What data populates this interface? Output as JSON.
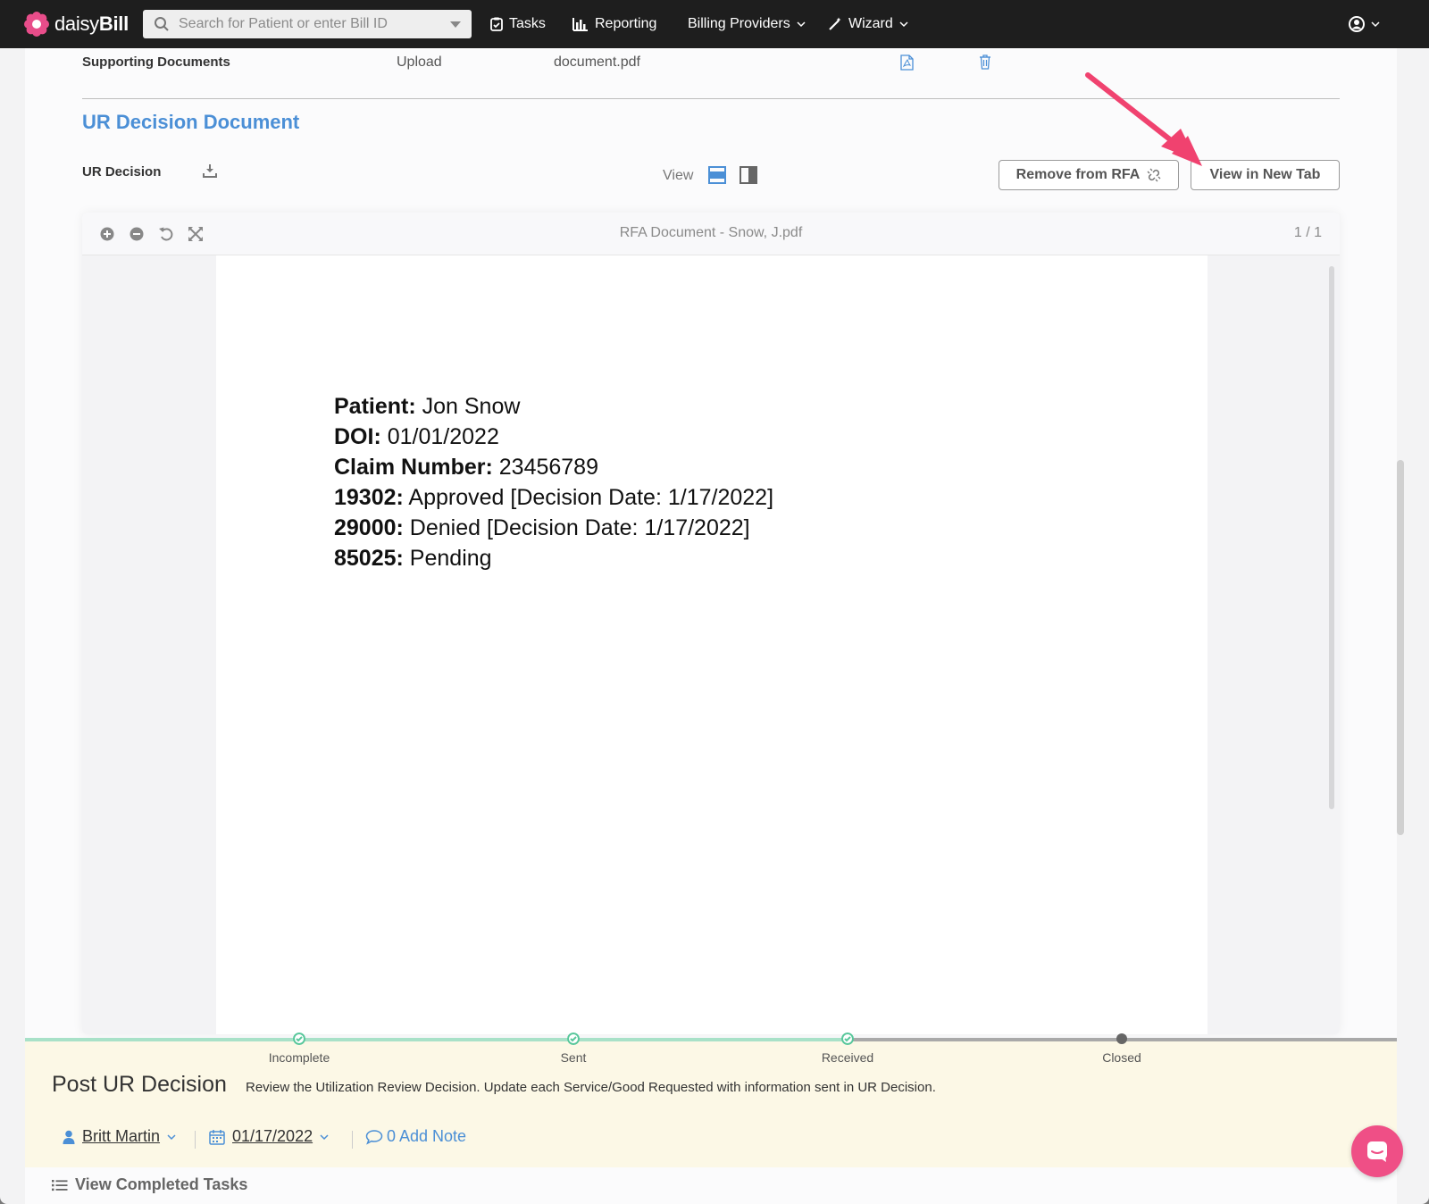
{
  "navbar": {
    "logo_text_light": "daisy",
    "logo_text_bold": "Bill",
    "search_placeholder": "Search for Patient or enter Bill ID",
    "items": {
      "tasks": "Tasks",
      "reporting": "Reporting",
      "billing_providers": "Billing Providers",
      "wizard": "Wizard"
    }
  },
  "supporting": {
    "label": "Supporting Documents",
    "source": "Upload",
    "filename": "document.pdf"
  },
  "ur_section": {
    "title": "UR Decision Document",
    "row_label": "UR Decision",
    "view_label": "View",
    "remove_button": "Remove from RFA",
    "new_tab_button": "View in New Tab"
  },
  "viewer": {
    "title": "RFA Document - Snow, J.pdf",
    "page_indicator": "1 / 1",
    "lines": [
      {
        "key": "Patient:",
        "value": " Jon Snow"
      },
      {
        "key": "DOI:",
        "value": " 01/01/2022"
      },
      {
        "key": "Claim Number:",
        "value": " 23456789"
      },
      {
        "key": "19302:",
        "value": " Approved [Decision Date: 1/17/2022]"
      },
      {
        "key": "29000:",
        "value": " Denied [Decision Date: 1/17/2022]"
      },
      {
        "key": "85025:",
        "value": " Pending"
      }
    ]
  },
  "task": {
    "steps": [
      "Incomplete",
      "Sent",
      "Received",
      "Closed"
    ],
    "title": "Post UR Decision",
    "description": "Review the Utilization Review Decision. Update each Service/Good Requested with information sent in UR Decision.",
    "assignee": "Britt Martin",
    "date": "01/17/2022",
    "note_label": "0 Add Note"
  },
  "footer": {
    "completed_tasks": "View Completed Tasks"
  },
  "colors": {
    "accent_blue": "#4b8fd6",
    "progress_green": "#a8e1c8",
    "arrow_pink": "#f0426f",
    "chat_pink": "#ef4f86",
    "task_bg": "#fcf8e6"
  }
}
